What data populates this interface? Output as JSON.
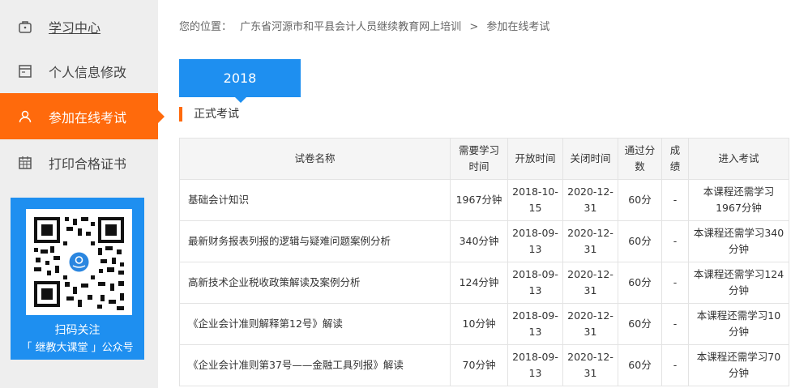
{
  "sidebar": {
    "items": [
      {
        "label": "学习中心",
        "icon": "briefcase-icon"
      },
      {
        "label": "个人信息修改",
        "icon": "id-card-icon"
      },
      {
        "label": "参加在线考试",
        "icon": "user-icon",
        "active": true
      },
      {
        "label": "打印合格证书",
        "icon": "calendar-icon"
      }
    ],
    "qr": {
      "line1": "扫码关注",
      "line2": "「 继教大课堂 」公众号"
    }
  },
  "breadcrumb": {
    "prefix": "您的位置：",
    "path": "广东省河源市和平县会计人员继续教育网上培训",
    "separator": ">",
    "current": "参加在线考试"
  },
  "year_tab": "2018",
  "section_title": "正式考试",
  "table": {
    "headers": [
      "试卷名称",
      "需要学习时间",
      "开放时间",
      "关闭时间",
      "通过分数",
      "成绩",
      "进入考试"
    ],
    "rows": [
      {
        "name": "基础会计知识",
        "study": "1967分钟",
        "open": "2018-10-15",
        "close": "2020-12-31",
        "pass": "60分",
        "score": "-",
        "enter": "本课程还需学习1967分钟"
      },
      {
        "name": "最新财务报表列报的逻辑与疑难问题案例分析",
        "study": "340分钟",
        "open": "2018-09-13",
        "close": "2020-12-31",
        "pass": "60分",
        "score": "-",
        "enter": "本课程还需学习340分钟"
      },
      {
        "name": "高新技术企业税收政策解读及案例分析",
        "study": "124分钟",
        "open": "2018-09-13",
        "close": "2020-12-31",
        "pass": "60分",
        "score": "-",
        "enter": "本课程还需学习124分钟"
      },
      {
        "name": "《企业会计准则解释第12号》解读",
        "study": "10分钟",
        "open": "2018-09-13",
        "close": "2020-12-31",
        "pass": "60分",
        "score": "-",
        "enter": "本课程还需学习10分钟"
      },
      {
        "name": "《企业会计准则第37号——金融工具列报》解读",
        "study": "70分钟",
        "open": "2018-09-13",
        "close": "2020-12-31",
        "pass": "60分",
        "score": "-",
        "enter": "本课程还需学习70分钟"
      }
    ]
  },
  "colors": {
    "accent_orange": "#ff6a0c",
    "accent_blue": "#1e8ff0",
    "sidebar_bg": "#eeeeee"
  }
}
